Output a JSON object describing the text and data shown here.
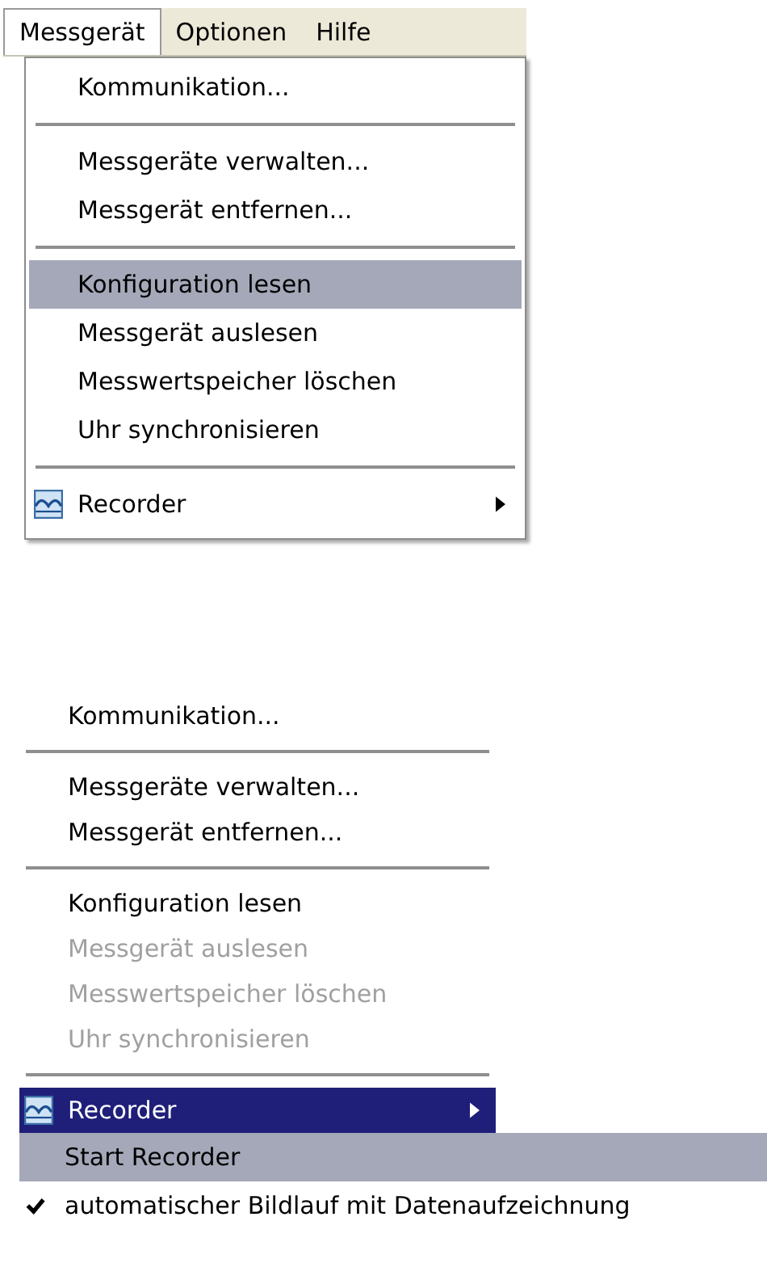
{
  "menubar": [
    {
      "label": "Messgerät",
      "selected": true
    },
    {
      "label": "Optionen",
      "selected": false
    },
    {
      "label": "Hilfe",
      "selected": false
    }
  ],
  "menus": [
    {
      "items": [
        {
          "kind": "item",
          "label": "Kommunikation...",
          "highlighted": false,
          "disabled": false
        },
        {
          "kind": "separator"
        },
        {
          "kind": "item",
          "label": "Messgeräte verwalten...",
          "highlighted": false,
          "disabled": false
        },
        {
          "kind": "item",
          "label": "Messgerät entfernen...",
          "highlighted": false,
          "disabled": false
        },
        {
          "kind": "separator"
        },
        {
          "kind": "item",
          "label": "Konfiguration lesen",
          "highlighted": true,
          "disabled": false
        },
        {
          "kind": "item",
          "label": "Messgerät auslesen",
          "highlighted": false,
          "disabled": false
        },
        {
          "kind": "item",
          "label": "Messwertspeicher löschen",
          "highlighted": false,
          "disabled": false
        },
        {
          "kind": "item",
          "label": "Uhr synchronisieren",
          "highlighted": false,
          "disabled": false
        },
        {
          "kind": "separator"
        },
        {
          "kind": "submenu",
          "label": "Recorder",
          "highlighted": false,
          "disabled": false
        }
      ]
    },
    {
      "items": [
        {
          "kind": "item",
          "label": "Kommunikation...",
          "highlighted": false,
          "disabled": false
        },
        {
          "kind": "separator"
        },
        {
          "kind": "item",
          "label": "Messgeräte verwalten...",
          "highlighted": false,
          "disabled": false
        },
        {
          "kind": "item",
          "label": "Messgerät entfernen...",
          "highlighted": false,
          "disabled": false
        },
        {
          "kind": "separator"
        },
        {
          "kind": "item",
          "label": "Konfiguration lesen",
          "highlighted": false,
          "disabled": false
        },
        {
          "kind": "item",
          "label": "Messgerät auslesen",
          "highlighted": false,
          "disabled": true
        },
        {
          "kind": "item",
          "label": "Messwertspeicher löschen",
          "highlighted": false,
          "disabled": true
        },
        {
          "kind": "item",
          "label": "Uhr synchronisieren",
          "highlighted": false,
          "disabled": true
        },
        {
          "kind": "separator"
        },
        {
          "kind": "submenu",
          "label": "Recorder",
          "highlighted": true,
          "disabled": false
        }
      ],
      "submenu": [
        {
          "label": "Start Recorder",
          "highlighted": true,
          "checked": false
        },
        {
          "label": "automatischer Bildlauf mit Datenaufzeichnung",
          "highlighted": false,
          "checked": true
        }
      ]
    }
  ]
}
